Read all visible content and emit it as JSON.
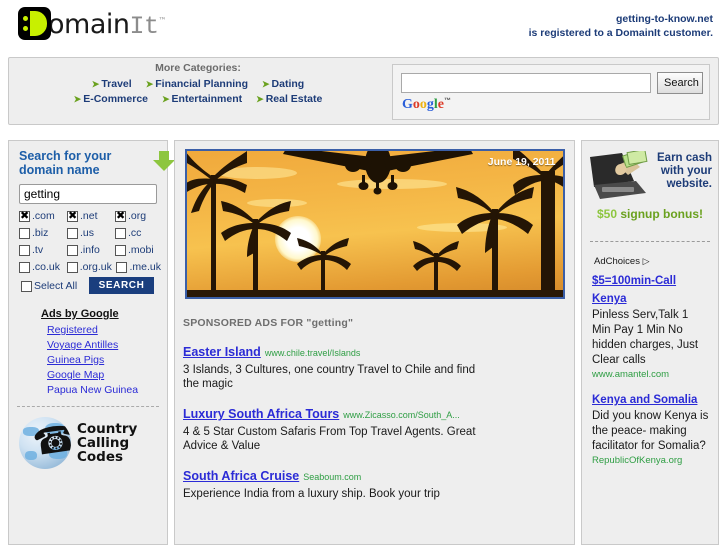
{
  "brand": {
    "logo_text": "omain",
    "logo_it": "It",
    "tm": "™"
  },
  "header": {
    "domain": "getting-to-know.net",
    "registered_note": "is registered to a DomainIt customer."
  },
  "categories": {
    "title": "More Categories:",
    "row1": [
      "Travel",
      "Financial Planning",
      "Dating"
    ],
    "row2": [
      "E-Commerce",
      "Entertainment",
      "Real Estate"
    ]
  },
  "google_search": {
    "value": "",
    "placeholder": "",
    "button_label": "Search",
    "logo": {
      "g1": "G",
      "o1": "o",
      "o2": "o",
      "g2": "g",
      "l": "l",
      "e": "e",
      "tm": "™"
    }
  },
  "domain_search": {
    "title_line1": "Search for your",
    "title_line2": "domain name",
    "input_value": "getting",
    "input_placeholder": "",
    "tlds": [
      {
        "label": ".com",
        "checked": true
      },
      {
        "label": ".net",
        "checked": true
      },
      {
        "label": ".org",
        "checked": true
      },
      {
        "label": ".biz",
        "checked": false
      },
      {
        "label": ".us",
        "checked": false
      },
      {
        "label": ".cc",
        "checked": false
      },
      {
        "label": ".tv",
        "checked": false
      },
      {
        "label": ".info",
        "checked": false
      },
      {
        "label": ".mobi",
        "checked": false
      },
      {
        "label": ".co.uk",
        "checked": false
      },
      {
        "label": ".org.uk",
        "checked": false
      },
      {
        "label": ".me.uk",
        "checked": false
      }
    ],
    "select_all_label": "Select All",
    "select_all_checked": false,
    "search_button": "SEARCH"
  },
  "ads_by_google": {
    "title": "Ads by Google",
    "links": [
      "Registered",
      "Voyage Antilles",
      "Guinea Pigs",
      "Google Map",
      "Papua New Guinea"
    ]
  },
  "country_calling_codes": {
    "line1": "Country",
    "line2": "Calling",
    "line3": "Codes"
  },
  "hero": {
    "date": "June 19, 2011",
    "alt": "tropical sunset with airplane and palm trees"
  },
  "sponsored": {
    "heading": "SPONSORED ADS FOR \"getting\"",
    "ads": [
      {
        "title": "Easter Island",
        "url": "www.chile.travel/Islands",
        "desc": "3 Islands, 3 Cultures, one country Travel to Chile and find the magic"
      },
      {
        "title": "Luxury South Africa Tours",
        "url": "www.Zicasso.com/South_A...",
        "desc": "4 & 5 Star Custom Safaris From Top Travel Agents. Great Advice & Value"
      },
      {
        "title": "South Africa Cruise",
        "url": "Seaboum.com",
        "desc": "Experience India from a luxury ship. Book your trip"
      }
    ]
  },
  "right_banner": {
    "line1": "Earn cash",
    "line2": "with your",
    "line3": "website.",
    "bonus_amount": "$50",
    "bonus_text": "signup bonus!"
  },
  "right_ads": {
    "adchoices_label": "AdChoices",
    "items": [
      {
        "title": "$5=100min-Call Kenya",
        "desc": "Pinless Serv,Talk 1 Min Pay 1 Min No hidden charges, Just Clear calls",
        "url": "www.amantel.com"
      },
      {
        "title": "Kenya and Somalia",
        "desc": "Did you know Kenya is the peace- making facilitator for Somalia?",
        "url": "RepublicOfKenya.org"
      }
    ]
  },
  "colors": {
    "brand_blue": "#1d3c78",
    "link_blue": "#2b2bd6",
    "accent_green": "#8dc63f",
    "url_green": "#2f9e44",
    "panel_bg": "#eeeeee",
    "button_navy": "#1a3e7e"
  }
}
